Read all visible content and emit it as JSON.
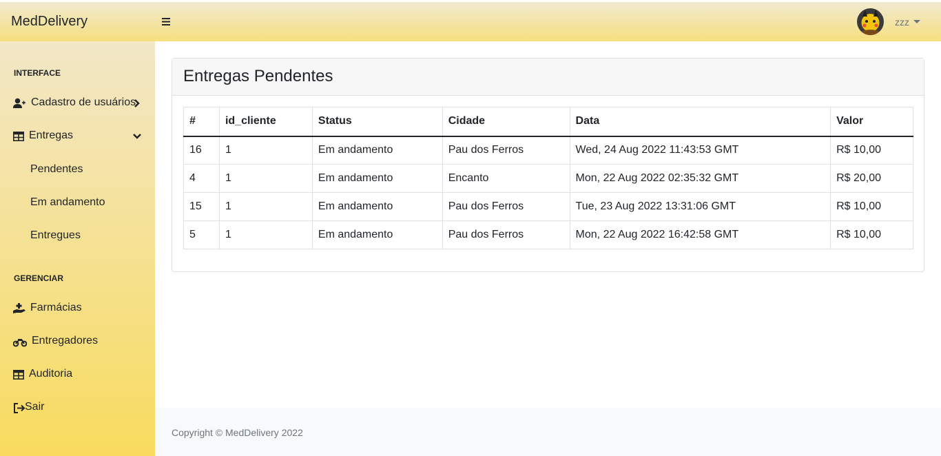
{
  "app": {
    "brand": "MedDelivery"
  },
  "user": {
    "name": "zzz"
  },
  "sidebar": {
    "heading_interface": "INTERFACE",
    "cadastro": "Cadastro de usuários",
    "entregas": "Entregas",
    "sub": [
      "Pendentes",
      "Em andamento",
      "Entregues"
    ],
    "heading_gerenciar": "GERENCIAR",
    "farmacias": "Farmácias",
    "entregadores": "Entregadores",
    "auditoria": "Auditoria",
    "sair": "Sair"
  },
  "card": {
    "title": "Entregas Pendentes"
  },
  "table": {
    "headers": [
      "#",
      "id_cliente",
      "Status",
      "Cidade",
      "Data",
      "Valor"
    ],
    "rows": [
      [
        "16",
        "1",
        "Em andamento",
        "Pau dos Ferros",
        "Wed, 24 Aug 2022 11:43:53 GMT",
        "R$ 10,00"
      ],
      [
        "4",
        "1",
        "Em andamento",
        "Encanto",
        "Mon, 22 Aug 2022 02:35:32 GMT",
        "R$ 20,00"
      ],
      [
        "15",
        "1",
        "Em andamento",
        "Pau dos Ferros",
        "Tue, 23 Aug 2022 13:31:06 GMT",
        "R$ 10,00"
      ],
      [
        "5",
        "1",
        "Em andamento",
        "Pau dos Ferros",
        "Mon, 22 Aug 2022 16:42:58 GMT",
        "R$ 10,00"
      ]
    ]
  },
  "footer": {
    "copyright": "Copyright © MedDelivery 2022"
  }
}
